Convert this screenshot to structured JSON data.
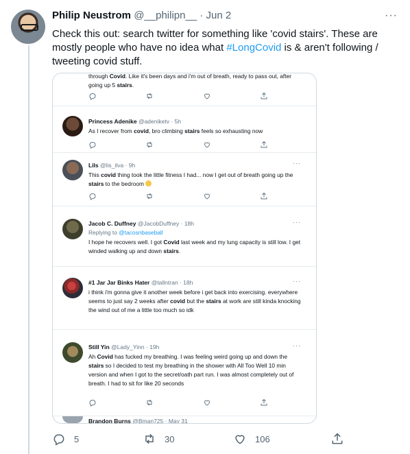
{
  "tweet": {
    "author_name": "Philip Neustrom",
    "author_handle": "@__philipn__",
    "separator": "·",
    "date": "Jun 2",
    "more": "···",
    "text_before": "Check this out: search twitter for something like 'covid stairs'. These are mostly people who have no idea what ",
    "hashtag": "#LongCovid",
    "text_after": " is & aren't following / tweeting covid stuff.",
    "replies": "5",
    "retweets": "30",
    "likes": "106"
  },
  "screenshot": {
    "tweets": [
      {
        "name": "",
        "handle": "",
        "text_html": "through <b>Covid</b>. Like it's been days and i'm out of breath, ready to pass out, after going up 5 <b>stairs</b>.",
        "reply_to_label": "",
        "reply_to_handle": ""
      },
      {
        "name": "Princess Adenike",
        "handle": "@adeniketv · 5h",
        "text_html": "As I recover from <b>covid</b>, bro climbing <b>stairs</b> feels so exhausting now",
        "reply_to_label": "",
        "reply_to_handle": ""
      },
      {
        "name": "Lils",
        "handle": "@lis_ilva · 9h",
        "text_html": "This <b>covid</b> thing took the little fitness I had... now I get out of breath going up the <b>stairs</b> to the bedroom",
        "reply_to_label": "",
        "reply_to_handle": ""
      },
      {
        "name": "Jacob C. Duffney",
        "handle": "@JacobDuffney · 18h",
        "text_html": "I hope he recovers well. I got <b>Covid</b> last week and my lung capacity is still low. I get winded walking up and down <b>stairs</b>.",
        "reply_to_label": "Replying to ",
        "reply_to_handle": "@tacosnbaseball"
      },
      {
        "name": "#1 Jar Jar Binks Hater",
        "handle": "@tallntran · 18h",
        "text_html": "i think i'm gonna give it another week before i get back into exercising. everywhere seems to just say 2 weeks after <b>covid</b> but the <b>stairs</b> at work are still kinda knocking the wind out of me a little too much so idk",
        "reply_to_label": "",
        "reply_to_handle": ""
      },
      {
        "name": "Still Yin",
        "handle": "@Lady_Yinn · 19h",
        "text_html": "Ah <b>Covid</b> has fucked my breathing. I was feeling weird going up and down the <b>stairs</b> so I decided to test my breathing in the shower with All Too Well 10 min version and when I got to the secret/oath part run. I was almost completely out of breath. I had to sit for like 20 seconds",
        "reply_to_label": "",
        "reply_to_handle": ""
      },
      {
        "name": "Brandon Burns",
        "handle": "@Bman725 · May 31",
        "text_html": "",
        "reply_to_label": "",
        "reply_to_handle": ""
      }
    ]
  },
  "icons": [
    "reply-icon",
    "retweet-icon",
    "like-icon",
    "share-icon",
    "more-icon"
  ],
  "colors": {
    "link": "#1d9bf0",
    "secondary": "#536471",
    "border": "#cfd9de"
  }
}
